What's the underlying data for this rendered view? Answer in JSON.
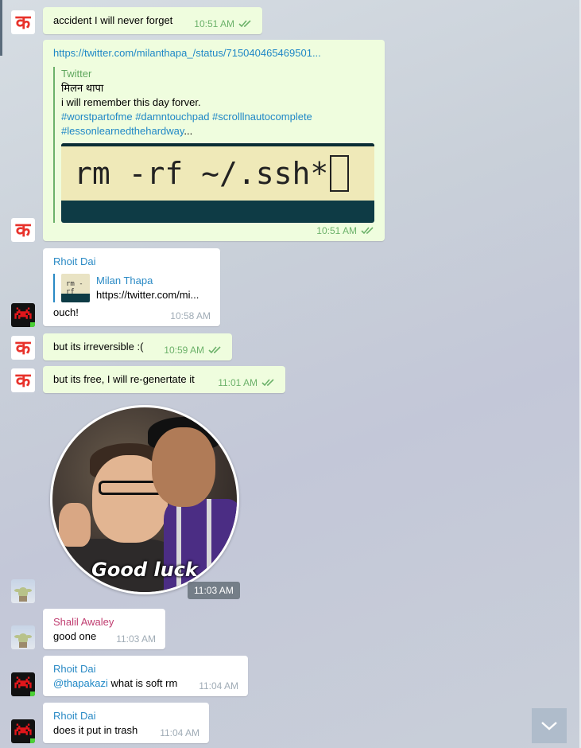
{
  "messages": {
    "m1": {
      "text": "accident I will never forget",
      "time": "10:51 AM"
    },
    "m2": {
      "url": "https://twitter.com/milanthapa_/status/715040465469501...",
      "preview": {
        "site": "Twitter",
        "author": "मिलन थापा",
        "line1": "i will remember this day forver.",
        "hashtags_line1": "#worstpartofme #damntouchpad #scrolllnautocomplete",
        "hashtags_line2": "#lessonlearnedthehardway",
        "ellipsis": "...",
        "terminal_text": "rm -rf ~/.ssh*"
      },
      "time": "10:51 AM"
    },
    "m3": {
      "sender": "Rhoit Dai",
      "reply_name": "Milan Thapa",
      "reply_text": "https://twitter.com/mi...",
      "reply_thumb_text": "rm -rf",
      "text": "ouch!",
      "time": "10:58 AM"
    },
    "m4": {
      "text": "but its irreversible :(",
      "time": "10:59 AM"
    },
    "m5": {
      "text": "but its free, I will re-genertate it",
      "time": "11:01 AM"
    },
    "sticker": {
      "caption": "Good luck",
      "time": "11:03 AM"
    },
    "m6": {
      "sender": "Shalil Awaley",
      "text": "good one",
      "time": "11:03 AM"
    },
    "m7": {
      "sender": "Rhoit Dai",
      "mention": "@thapakazi",
      "text": " what is soft rm",
      "time": "11:04 AM"
    },
    "m8": {
      "sender": "Rhoit Dai",
      "text": "does it put in trash",
      "time": "11:04 AM"
    }
  },
  "avatars": {
    "ka_glyph": "क"
  },
  "colors": {
    "outgoing_bubble": "#effdde",
    "incoming_bubble": "#ffffff",
    "read_ticks": "#6cb26a",
    "link": "#1f88c6",
    "sender_blue": "#2a8ac5",
    "sender_pink": "#c03d70"
  },
  "icons": {
    "read": "double-check-icon",
    "scroll": "chevron-down-icon"
  }
}
